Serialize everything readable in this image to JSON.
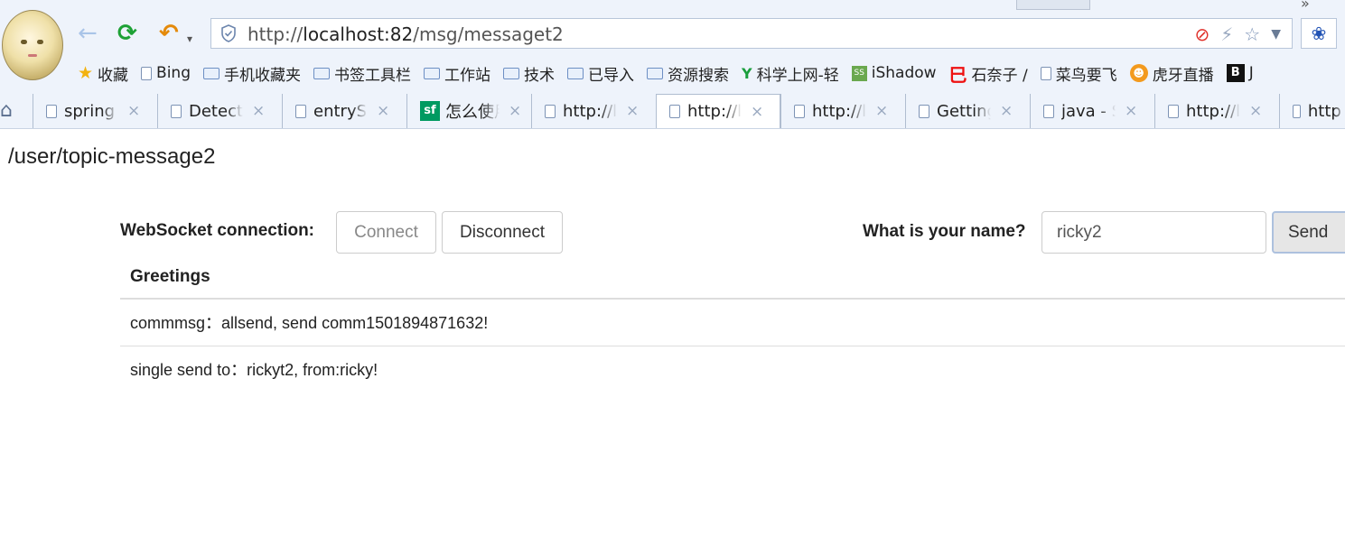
{
  "browser": {
    "url_scheme": "http://",
    "url_host": "localhost:82",
    "url_path": "/msg/messaget2",
    "back_icon": "←",
    "refresh_icon": "⟳",
    "undo_icon": "↶",
    "bookmarks": [
      {
        "label": "收藏",
        "icon": "star-icon"
      },
      {
        "label": "Bing",
        "icon": "page-icon"
      },
      {
        "label": "手机收藏夹",
        "icon": "folder-icon"
      },
      {
        "label": "书签工具栏",
        "icon": "folder-icon"
      },
      {
        "label": "工作站",
        "icon": "folder-icon"
      },
      {
        "label": "技术",
        "icon": "folder-icon"
      },
      {
        "label": "已导入",
        "icon": "folder-icon"
      },
      {
        "label": "资源搜索",
        "icon": "folder-icon"
      },
      {
        "label": "科学上网-轻",
        "icon": "y-icon"
      },
      {
        "label": "iShadow",
        "icon": "ss-icon"
      },
      {
        "label": "石奈子 /",
        "icon": "red-logo-icon"
      },
      {
        "label": "菜鸟要飞",
        "icon": "page-icon"
      },
      {
        "label": "虎牙直播",
        "icon": "tiger-icon"
      },
      {
        "label": "J",
        "icon": "b-icon"
      }
    ],
    "tabs": [
      {
        "label": "spring"
      },
      {
        "label": "Detecti"
      },
      {
        "label": "entrySe"
      },
      {
        "label": "怎么使用"
      },
      {
        "label": "http://l"
      },
      {
        "label": "http://l"
      },
      {
        "label": "http://l"
      },
      {
        "label": "Getting"
      },
      {
        "label": "java - S"
      },
      {
        "label": "http://l"
      },
      {
        "label": "http"
      }
    ],
    "close_glyph": "×"
  },
  "page": {
    "heading": "/user/topic-message2",
    "ws_label": "WebSocket connection:",
    "connect_label": "Connect",
    "disconnect_label": "Disconnect",
    "name_label": "What is your name?",
    "name_value": "ricky2",
    "send_label": "Send",
    "greetings_header": "Greetings",
    "greetings": [
      "commmsg：allsend, send comm1501894871632!",
      "single send to：rickyt2, from:ricky!"
    ]
  }
}
